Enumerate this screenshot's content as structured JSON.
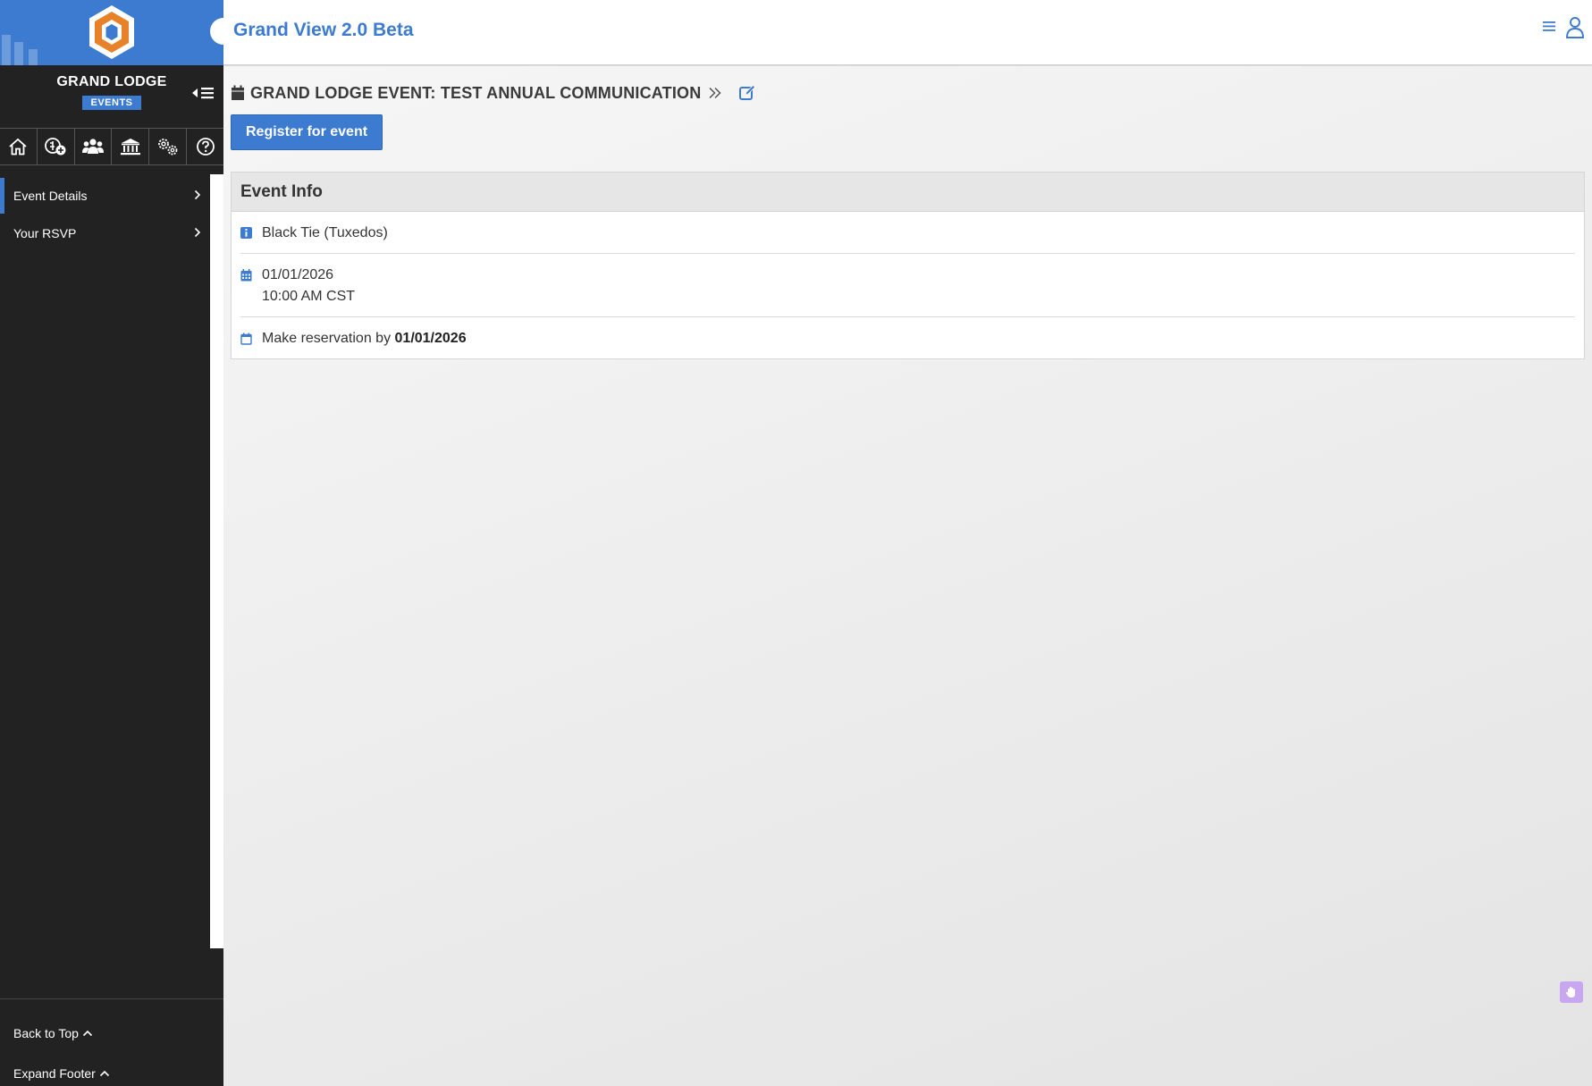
{
  "header": {
    "app_title": "Grand View 2.0 Beta"
  },
  "sidebar": {
    "org_name": "GRAND LODGE",
    "org_badge": "EVENTS",
    "icon_nav": [
      {
        "icon": "home-icon"
      },
      {
        "icon": "lodge-add-icon"
      },
      {
        "icon": "members-icon"
      },
      {
        "icon": "bank-icon"
      },
      {
        "icon": "settings-icon"
      },
      {
        "icon": "help-icon"
      }
    ],
    "menu": [
      {
        "label": "Event Details",
        "active": true
      },
      {
        "label": "Your RSVP",
        "active": false
      }
    ],
    "footer": {
      "back_to_top": "Back to Top",
      "expand_footer": "Expand Footer"
    }
  },
  "main": {
    "page_title": "GRAND LODGE EVENT: TEST ANNUAL COMMUNICATION",
    "register_button": "Register for event",
    "panel": {
      "title": "Event Info",
      "dress_code": "Black Tie (Tuxedos)",
      "date": "01/01/2026",
      "time": "10:00 AM CST",
      "reservation_prefix": "Make reservation by",
      "reservation_date": "01/01/2026"
    }
  },
  "colors": {
    "accent": "#3d7bd0",
    "sidebar_bg": "#222222",
    "logo_orange": "#e8822a"
  }
}
